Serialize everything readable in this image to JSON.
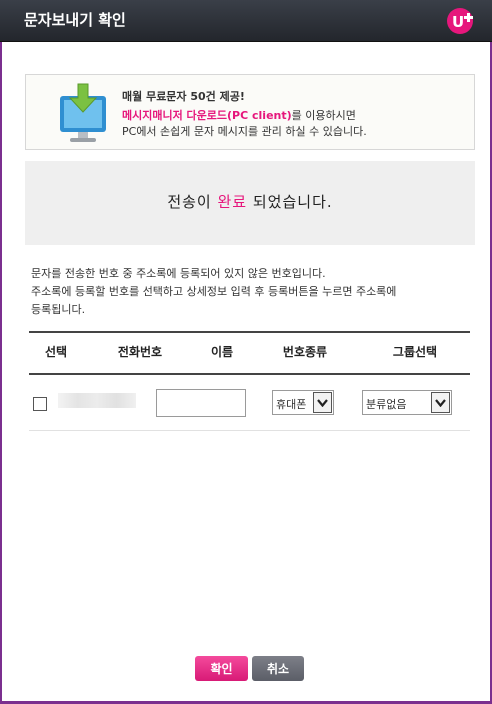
{
  "window": {
    "title": "문자보내기 확인"
  },
  "brand": {
    "logo_icon": "uplus-logo-icon",
    "color": "#e6177c"
  },
  "banner": {
    "icon": "monitor-download-icon",
    "line1": "매월 무료문자 50건 제공!",
    "line2_highlight": "메시지매니저 다운로드(PC client)",
    "line2_rest": "를 이용하시면",
    "line3": "PC에서 손쉽게 문자 메시지를 관리 하실 수 있습니다."
  },
  "notice": {
    "msg_before": "전송이 ",
    "msg_highlight": "완료",
    "msg_after": " 되었습니다."
  },
  "description": {
    "line1": "문자를 전송한 번호 중 주소록에 등록되어 있지 않은 번호입니다.",
    "line2": "주소록에 등록할 번호를 선택하고 상세정보 입력 후 등록버튼을 누르면 주소록에",
    "line3": "등록됩니다."
  },
  "table": {
    "headers": [
      "선택",
      "전화번호",
      "이름",
      "번호종류",
      "그룹선택"
    ],
    "rows": [
      {
        "checked": false,
        "name_value": "",
        "number_type": "휴대폰",
        "group": "분류없음"
      }
    ]
  },
  "buttons": {
    "ok": "확인",
    "cancel": "취소"
  }
}
